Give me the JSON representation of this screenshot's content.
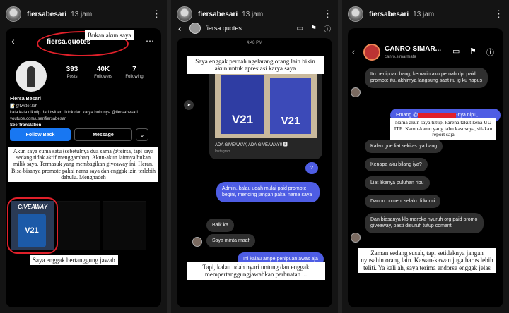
{
  "panels": [
    {
      "story_user": "fiersabesari",
      "story_time": "13 jam",
      "more": "⋮"
    },
    {
      "story_user": "fiersabesari",
      "story_time": "13 jam",
      "more": "⋮"
    },
    {
      "story_user": "fiersabesari",
      "story_time": "13 jam",
      "more": "⋮"
    }
  ],
  "profile": {
    "back": "‹",
    "username": "fiersa.quotes",
    "menu": "⋯",
    "stats": [
      {
        "value": "393",
        "label": "Posts"
      },
      {
        "value": "40K",
        "label": "Followers"
      },
      {
        "value": "7",
        "label": "Following"
      }
    ],
    "bio_name": "Fiersa Besari",
    "bio_line1": "📝@twitter.lah",
    "bio_line2": "kata kata dikutip dari twitter, tiktok dan karya bukunya @fiersabesari",
    "bio_line3": "youtube.com/user/fiersabesari",
    "see_translation": "See Translation",
    "follow_label": "Follow Back",
    "message_label": "Message",
    "dropdown": "⌄",
    "giveaway_tile_text": "GIVEAWAY",
    "giveaway_phone": "V21",
    "caption_top": "Bukan akun saya",
    "caption_mid": "Akun saya cuma satu (sebetulnya dua sama @feirsa, tapi saya sedang tidak aktif menggambar). Akun-akun lainnya bukan milik saya. Termasuk yang membagikan giveaway ini. Heran. Bisa-bisanya promote pakai nama saya dan enggak izin terlebih dahulu. Menghadeh",
    "caption_bottom": "Saya enggak bertanggung jawab"
  },
  "chat2": {
    "back": "‹",
    "title": "fiersa.quotes",
    "time": "4:48 PM",
    "caption_top": "Saya enggak pernah ngelarang orang lain bikin akun untuk apresiasi karya saya",
    "post_phone_1": "V21",
    "post_phone_2": "V21",
    "post_caption": "ADA GIVEAWAY, ADA GIVEAWAY!! 🅿",
    "post_source": "Instagram",
    "share_icon": "➤",
    "out_q": "?",
    "out_msg": "Admin, kalau udah mulai paid promote begini, mending jangan pakai nama saya",
    "in_1": "Baik ka",
    "in_2": "Saya minta maaf",
    "out_2": "Ini kalau ampe penipuan awas aja",
    "caption_bottom": "Tapi, kalau udah nyari untung dan enggak mempertanggungjawabkan perbuatan ..."
  },
  "chat3": {
    "back": "‹",
    "name": "CANRO SIMAR...",
    "handle": "canro.simarmata",
    "in_1": "Itu penipuan bang, kemarin aku pernah dpt paid promote itu, akhirnya langsung saat itu jg ku hapus",
    "out_1_prefix": "Emang @",
    "out_1_suffix": "-nya nipu,",
    "caption_mid": "Nama akun saya tutup, karena takut kena UU ITE. Kamu-kamu yang tahu kasusnya, silakan report saja",
    "in_2": "Kalau gue liat sekilas iya bang",
    "in_3": "Kenapa aku bilang iya?",
    "in_4": "Liat likenya puluhan ribu",
    "in_5": "Dannn coment selalu di kunci",
    "in_6": "Dan biasanya klo mereka nyuruh org paid promo giveaway, pasti disuruh tutup coment",
    "caption_bottom": "Zaman sedang susah, tapi setidaknya jangan nyusahin orang lain. Kawan-kawan juga harus lebih teliti. Ya kali ah, saya terima endorse enggak jelas"
  },
  "colors": {
    "accent_blue": "#4e5de4",
    "follow_blue": "#1877f2",
    "red_mark": "#e0202a"
  }
}
